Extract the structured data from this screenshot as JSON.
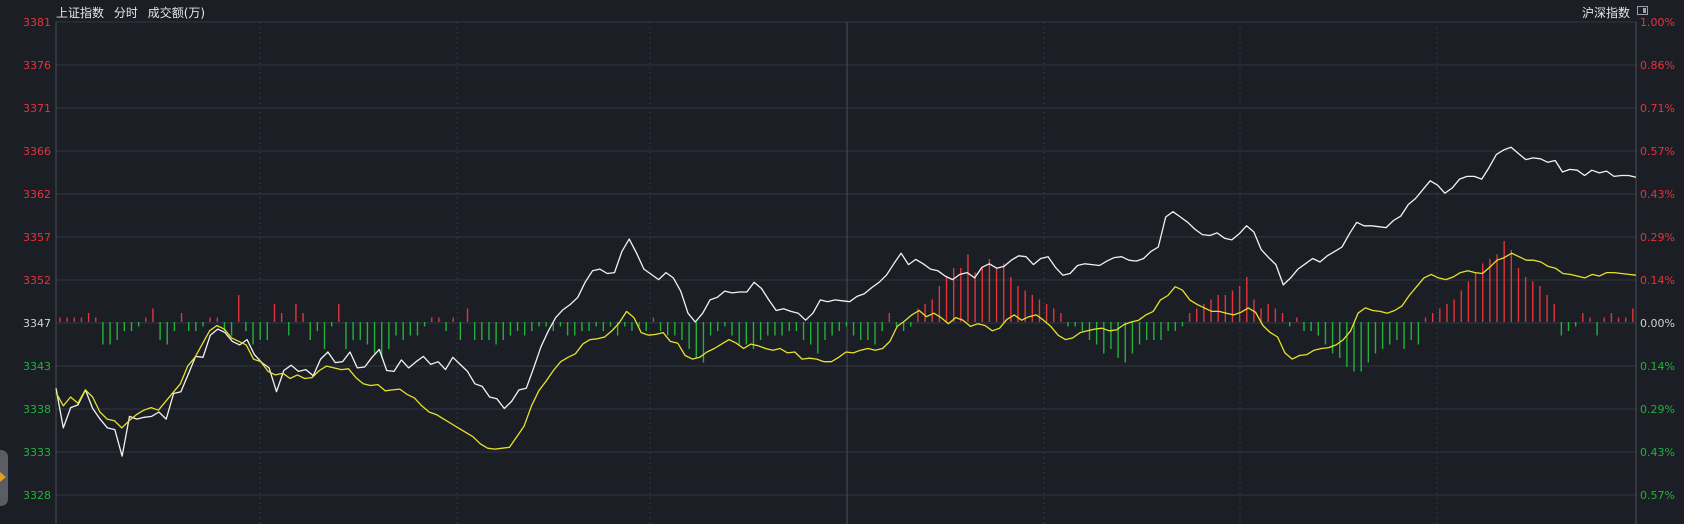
{
  "header": {
    "index_name": "上证指数",
    "mode_label": "分时",
    "volume_label": "成交额(万)",
    "compare_label": "沪深指数"
  },
  "colors": {
    "background": "#1b1e25",
    "grid": "#31353e",
    "up": "#e5333c",
    "down": "#1fb33a",
    "flat": "#cfd3d8",
    "price_line": "#f2f2f2",
    "avg_line": "#e6e22a"
  },
  "icons": [
    "panel-toggle-icon",
    "expand-arrow-icon"
  ],
  "chart_data": {
    "type": "line",
    "title": "",
    "xlabel": "",
    "ylabel": "",
    "ylim": [
      3328,
      3381
    ],
    "pct_range": [
      -0.57,
      1.0
    ],
    "base_value": 3347,
    "grid": true,
    "y_ticks_left": [
      "3381",
      "3376",
      "3371",
      "3366",
      "3362",
      "3357",
      "3352",
      "3347",
      "3343",
      "3338",
      "3333",
      "3328"
    ],
    "y_ticks_right": [
      "1.00%",
      "0.86%",
      "0.71%",
      "0.57%",
      "0.43%",
      "0.29%",
      "0.14%",
      "0.00%",
      "0.14%",
      "0.29%",
      "0.43%",
      "0.57%"
    ],
    "series": [
      {
        "role": "price",
        "values": [
          3339.5,
          3335.0,
          3337.3,
          3337.6,
          3339.3,
          3337.2,
          3336.0,
          3335.0,
          3334.8,
          3331.8,
          3336.3,
          3336.0,
          3336.2,
          3336.3,
          3336.8,
          3336.0,
          3338.9,
          3339.1,
          3341.1,
          3343.1,
          3343.0,
          3345.5,
          3346.2,
          3345.8,
          3344.8,
          3344.4,
          3345.0,
          3343.3,
          3342.4,
          3341.8,
          3339.1,
          3341.5,
          3342.1,
          3341.4,
          3341.6,
          3340.9,
          3342.8,
          3343.6,
          3342.4,
          3342.5,
          3343.6,
          3341.8,
          3341.9,
          3343.0,
          3343.9,
          3341.5,
          3341.4,
          3342.7,
          3341.8,
          3342.5,
          3343.1,
          3342.2,
          3342.5,
          3341.6,
          3343.0,
          3342.2,
          3341.4,
          3340.0,
          3339.7,
          3338.5,
          3338.3,
          3337.2,
          3338.0,
          3339.3,
          3339.5,
          3341.8,
          3344.2,
          3346.0,
          3347.5,
          3348.4,
          3349.0,
          3349.8,
          3351.5,
          3352.8,
          3353.0,
          3352.5,
          3352.6,
          3355.0,
          3356.4,
          3354.8,
          3353.0,
          3352.4,
          3351.8,
          3352.6,
          3352.0,
          3350.5,
          3348.0,
          3347.0,
          3348.0,
          3349.5,
          3349.8,
          3350.5,
          3350.3,
          3350.4,
          3350.4,
          3351.5,
          3350.8,
          3349.5,
          3348.3,
          3348.5,
          3348.2,
          3348.0,
          3347.2,
          3348.0,
          3349.5,
          3349.3,
          3349.5,
          3349.4,
          3349.3,
          3349.9,
          3350.2,
          3350.9,
          3351.5,
          3352.3,
          3353.6,
          3354.8,
          3353.5,
          3354.1,
          3353.6,
          3353.0,
          3352.8,
          3352.2,
          3351.8,
          3352.4,
          3352.6,
          3352.0,
          3353.2,
          3353.6,
          3353.1,
          3353.3,
          3354.0,
          3354.5,
          3354.4,
          3353.5,
          3354.2,
          3354.4,
          3353.2,
          3352.3,
          3352.5,
          3353.4,
          3353.6,
          3353.5,
          3353.4,
          3353.9,
          3354.3,
          3354.4,
          3354.0,
          3353.9,
          3354.2,
          3355.0,
          3355.5,
          3358.9,
          3359.5,
          3358.9,
          3358.3,
          3357.5,
          3356.9,
          3356.8,
          3357.1,
          3356.5,
          3356.3,
          3357.0,
          3357.9,
          3357.2,
          3355.2,
          3354.3,
          3353.5,
          3351.2,
          3352.0,
          3353.0,
          3353.6,
          3354.2,
          3353.8,
          3354.5,
          3355.0,
          3355.5,
          3357.0,
          3358.3,
          3357.9,
          3357.9,
          3357.8,
          3357.7,
          3358.5,
          3359.0,
          3360.3,
          3361.0,
          3362.0,
          3363.0,
          3362.5,
          3361.6,
          3362.2,
          3363.2,
          3363.5,
          3363.5,
          3363.2,
          3364.5,
          3366.0,
          3366.5,
          3366.8,
          3366.1,
          3365.4,
          3365.6,
          3365.5,
          3365.1,
          3365.3,
          3364.0,
          3364.3,
          3364.2,
          3363.6,
          3364.2,
          3363.9,
          3364.1,
          3363.5,
          3363.6,
          3363.6,
          3363.4
        ]
      },
      {
        "role": "average",
        "values": [
          3339.0,
          3337.5,
          3338.5,
          3337.8,
          3339.3,
          3338.5,
          3336.8,
          3336.0,
          3335.8,
          3335.0,
          3335.8,
          3336.5,
          3337.0,
          3337.3,
          3337.0,
          3338.0,
          3339.0,
          3340.0,
          3342.0,
          3343.0,
          3344.5,
          3346.0,
          3346.6,
          3346.2,
          3345.2,
          3344.8,
          3344.4,
          3342.8,
          3342.5,
          3341.4,
          3341.0,
          3341.2,
          3340.6,
          3341.0,
          3340.6,
          3340.7,
          3341.5,
          3342.0,
          3341.8,
          3341.6,
          3341.7,
          3340.7,
          3340.0,
          3339.8,
          3339.9,
          3339.2,
          3339.3,
          3339.4,
          3338.8,
          3338.4,
          3337.5,
          3336.8,
          3336.5,
          3336.0,
          3335.5,
          3335.0,
          3334.5,
          3334.0,
          3333.2,
          3332.7,
          3332.6,
          3332.7,
          3332.8,
          3334.0,
          3335.2,
          3337.5,
          3339.2,
          3340.3,
          3341.5,
          3342.5,
          3343.0,
          3343.4,
          3344.5,
          3345.0,
          3345.1,
          3345.3,
          3346.0,
          3346.9,
          3348.2,
          3347.5,
          3345.8,
          3345.5,
          3345.6,
          3345.8,
          3344.8,
          3344.6,
          3343.2,
          3342.8,
          3343.0,
          3343.6,
          3344.0,
          3344.5,
          3345.0,
          3344.6,
          3344.0,
          3344.5,
          3344.3,
          3344.0,
          3343.8,
          3344.0,
          3343.5,
          3343.6,
          3342.8,
          3342.9,
          3342.8,
          3342.5,
          3342.5,
          3343.0,
          3343.6,
          3343.5,
          3343.8,
          3344.0,
          3343.8,
          3344.0,
          3344.8,
          3346.5,
          3347.1,
          3347.8,
          3348.3,
          3347.6,
          3348.0,
          3347.5,
          3346.8,
          3347.5,
          3347.2,
          3346.5,
          3346.8,
          3346.6,
          3346.0,
          3346.3,
          3347.3,
          3347.8,
          3347.2,
          3347.6,
          3347.8,
          3347.2,
          3346.5,
          3345.5,
          3345.0,
          3345.2,
          3345.8,
          3346.0,
          3346.2,
          3346.3,
          3346.0,
          3346.1,
          3346.7,
          3347.0,
          3347.2,
          3347.8,
          3348.2,
          3349.5,
          3350.0,
          3351.0,
          3350.6,
          3349.5,
          3349.0,
          3348.6,
          3348.2,
          3348.2,
          3348.0,
          3347.8,
          3348.1,
          3348.6,
          3348.1,
          3346.6,
          3345.8,
          3345.3,
          3343.5,
          3342.8,
          3343.2,
          3343.3,
          3343.8,
          3344.0,
          3344.1,
          3344.4,
          3345.0,
          3346.0,
          3348.0,
          3348.6,
          3348.3,
          3348.2,
          3348.0,
          3348.3,
          3348.8,
          3350.0,
          3351.0,
          3352.0,
          3352.4,
          3352.0,
          3351.8,
          3352.1,
          3352.6,
          3352.8,
          3352.6,
          3352.5,
          3353.2,
          3354.0,
          3354.3,
          3354.8,
          3354.4,
          3354.0,
          3354.0,
          3353.8,
          3353.3,
          3353.1,
          3352.5,
          3352.4,
          3352.2,
          3352.0,
          3352.4,
          3352.2,
          3352.6,
          3352.6,
          3352.5,
          3352.4,
          3352.3
        ]
      }
    ],
    "volume_values": [
      1,
      1,
      1,
      1,
      2,
      1,
      -5,
      -5,
      -4,
      -2,
      -2,
      -1,
      1,
      3,
      -4,
      -5,
      -2,
      2,
      -2,
      -2,
      -1,
      1,
      1,
      -2,
      -3,
      6,
      -2,
      -5,
      -4,
      -4,
      4,
      2,
      -3,
      4,
      2,
      -4,
      -2,
      -6,
      -1,
      4,
      -6,
      -4,
      -4,
      -5,
      -7,
      -8,
      -6,
      -3,
      -4,
      -3,
      -3,
      -1,
      1,
      1,
      -2,
      1,
      -4,
      3,
      -4,
      -4,
      -4,
      -5,
      -4,
      -3,
      -2,
      -3,
      -2,
      -1,
      -1,
      -2,
      -1,
      -3,
      -3,
      -2,
      -2,
      -1,
      -2,
      -1,
      -3,
      -1,
      -2,
      -1,
      -2,
      1,
      -2,
      -3,
      -3,
      -4,
      -6,
      -8,
      -9,
      -3,
      -2,
      -1,
      -3,
      -5,
      -5,
      -6,
      -4,
      -3,
      -3,
      -3,
      -2,
      -2,
      -4,
      -5,
      -7,
      -4,
      -3,
      -2,
      -1,
      -3,
      -4,
      -4,
      -5,
      -2,
      2,
      -1,
      -2,
      -1,
      3,
      4,
      5,
      8,
      10,
      12,
      12,
      15,
      11,
      12,
      14,
      12,
      13,
      10,
      8,
      7,
      6,
      5,
      4,
      3,
      2,
      -1,
      -1,
      -2,
      -4,
      -5,
      -7,
      -6,
      -8,
      -9,
      -7,
      -5,
      -4,
      -4,
      -4,
      -2,
      -2,
      -1,
      2,
      3,
      4,
      5,
      6,
      6,
      7,
      8,
      10,
      5,
      3,
      4,
      3,
      2,
      -1,
      1,
      -2,
      -2,
      -3,
      -5,
      -7,
      -8,
      -10,
      -11,
      -11,
      -9,
      -7,
      -6,
      -5,
      -4,
      -6,
      -4,
      -5,
      1,
      2,
      3,
      4,
      5,
      7,
      9,
      11,
      13,
      14,
      15,
      18,
      16,
      12,
      10,
      9,
      8,
      6,
      4,
      -3,
      -2,
      -1,
      2,
      1,
      -3,
      1,
      2,
      1,
      1,
      3
    ]
  }
}
